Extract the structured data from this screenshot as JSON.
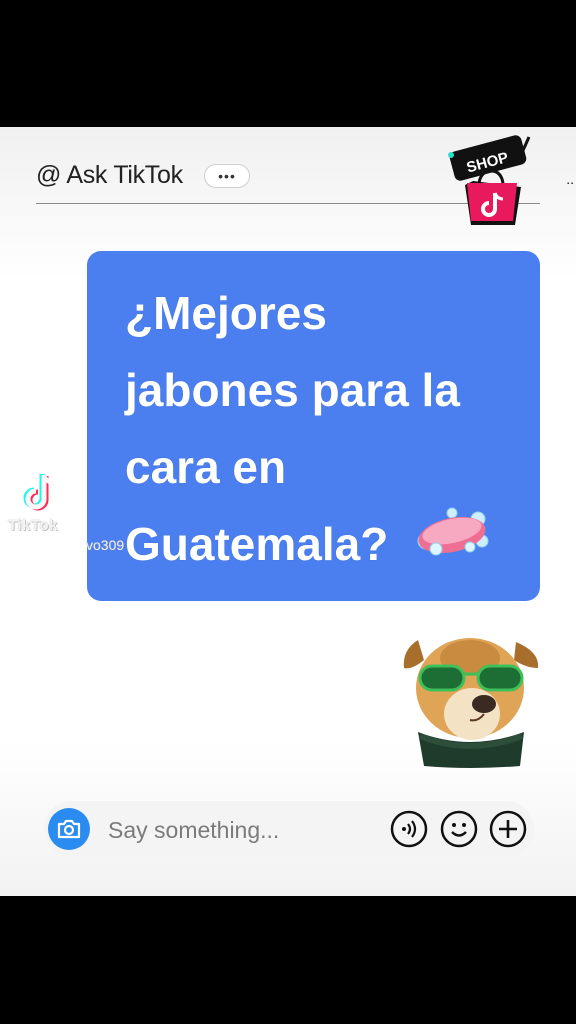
{
  "header": {
    "title": "@ Ask TikTok",
    "dots": "•••",
    "more": "..",
    "shop_badge_text": "SHOP"
  },
  "bubble": {
    "lines": [
      "¿Mejores",
      "jabones para la",
      "cara en",
      "Guatemala?"
    ],
    "emoji_icon": "soap-icon"
  },
  "watermark": {
    "brand": "TikTok",
    "username": "vo309"
  },
  "composer": {
    "placeholder": "Say something...",
    "icons": [
      "camera-icon",
      "voice-icon",
      "emoji-icon",
      "plus-icon"
    ]
  },
  "colors": {
    "bubble": "#4b7ff0",
    "camera": "#2a8cf0",
    "shop_pink": "#e9195d"
  }
}
